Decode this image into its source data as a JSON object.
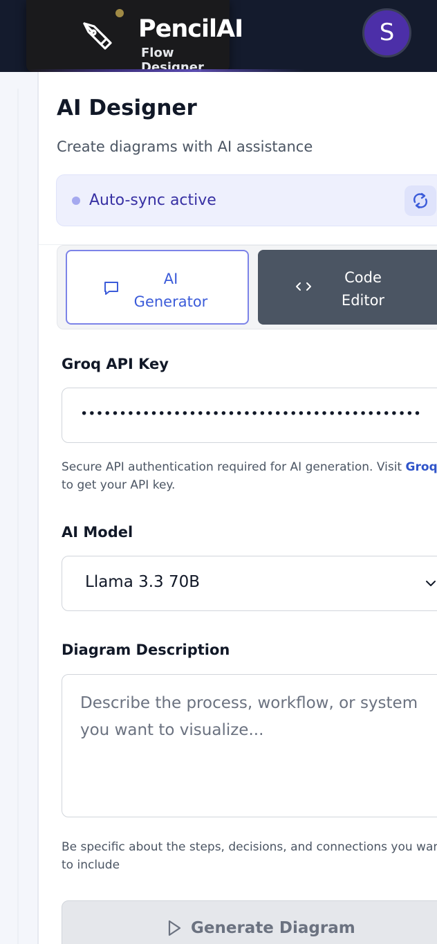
{
  "brand": {
    "name": "PencilAI",
    "subtitle": "Flow Designer"
  },
  "user": {
    "avatar_initial": "S"
  },
  "panel": {
    "title": "AI Designer",
    "subtitle": "Create diagrams with AI assistance",
    "sync_status": "Auto-sync active"
  },
  "tabs": [
    {
      "label_line1": "AI",
      "label_line2": "Generator",
      "icon": "chat-icon",
      "selected": true
    },
    {
      "label_line1": "Code",
      "label_line2": "Editor",
      "icon": "code-icon",
      "selected": false
    }
  ],
  "form": {
    "api_key": {
      "label": "Groq API Key",
      "value": "••••••••••••••••••••••••••••••••••••••••••••",
      "help_prefix": "Secure API authentication required for AI generation. Visit ",
      "help_link": "Groq",
      "help_suffix": "to get your API key."
    },
    "model": {
      "label": "AI Model",
      "selected": "Llama 3.3 70B"
    },
    "description": {
      "label": "Diagram Description",
      "placeholder": "Describe the process, workflow, or system you want to visualize...",
      "help": "Be specific about the steps, decisions, and connections you want to include"
    },
    "submit_label": "Generate Diagram"
  },
  "colors": {
    "topbar": "#141b2d",
    "accent": "#3b5bd9",
    "avatar": "#4c2fa8",
    "sync_bg": "#eef0fd"
  }
}
